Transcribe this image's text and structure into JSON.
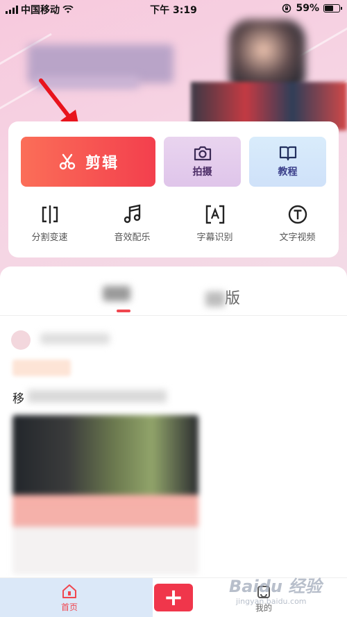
{
  "status_bar": {
    "carrier": "中国移动",
    "time": "下午 3:19",
    "battery": "59%",
    "battery_level": 0.59
  },
  "tools": {
    "edit_label": "剪辑",
    "shoot_label": "拍摄",
    "course_label": "教程",
    "items": [
      {
        "label": "分割变速",
        "icon": "split-speed-icon"
      },
      {
        "label": "音效配乐",
        "icon": "music-note-icon"
      },
      {
        "label": "字幕识别",
        "icon": "subtitle-recognize-icon"
      },
      {
        "label": "文字视频",
        "icon": "text-video-icon"
      }
    ]
  },
  "feed": {
    "tab_2": "版",
    "post_title_prefix": "移"
  },
  "tabbar": {
    "home_label": "首页",
    "add_label": "+",
    "mine_label": "我的"
  },
  "watermark": {
    "brand": "Baidu 经验",
    "url": "jingyan.baidu.com"
  },
  "colors": {
    "accent": "#f0464f",
    "edit_gradient_start": "#fb6e58",
    "edit_gradient_end": "#f33f4d",
    "banner_pink": "#f7c9dd"
  }
}
